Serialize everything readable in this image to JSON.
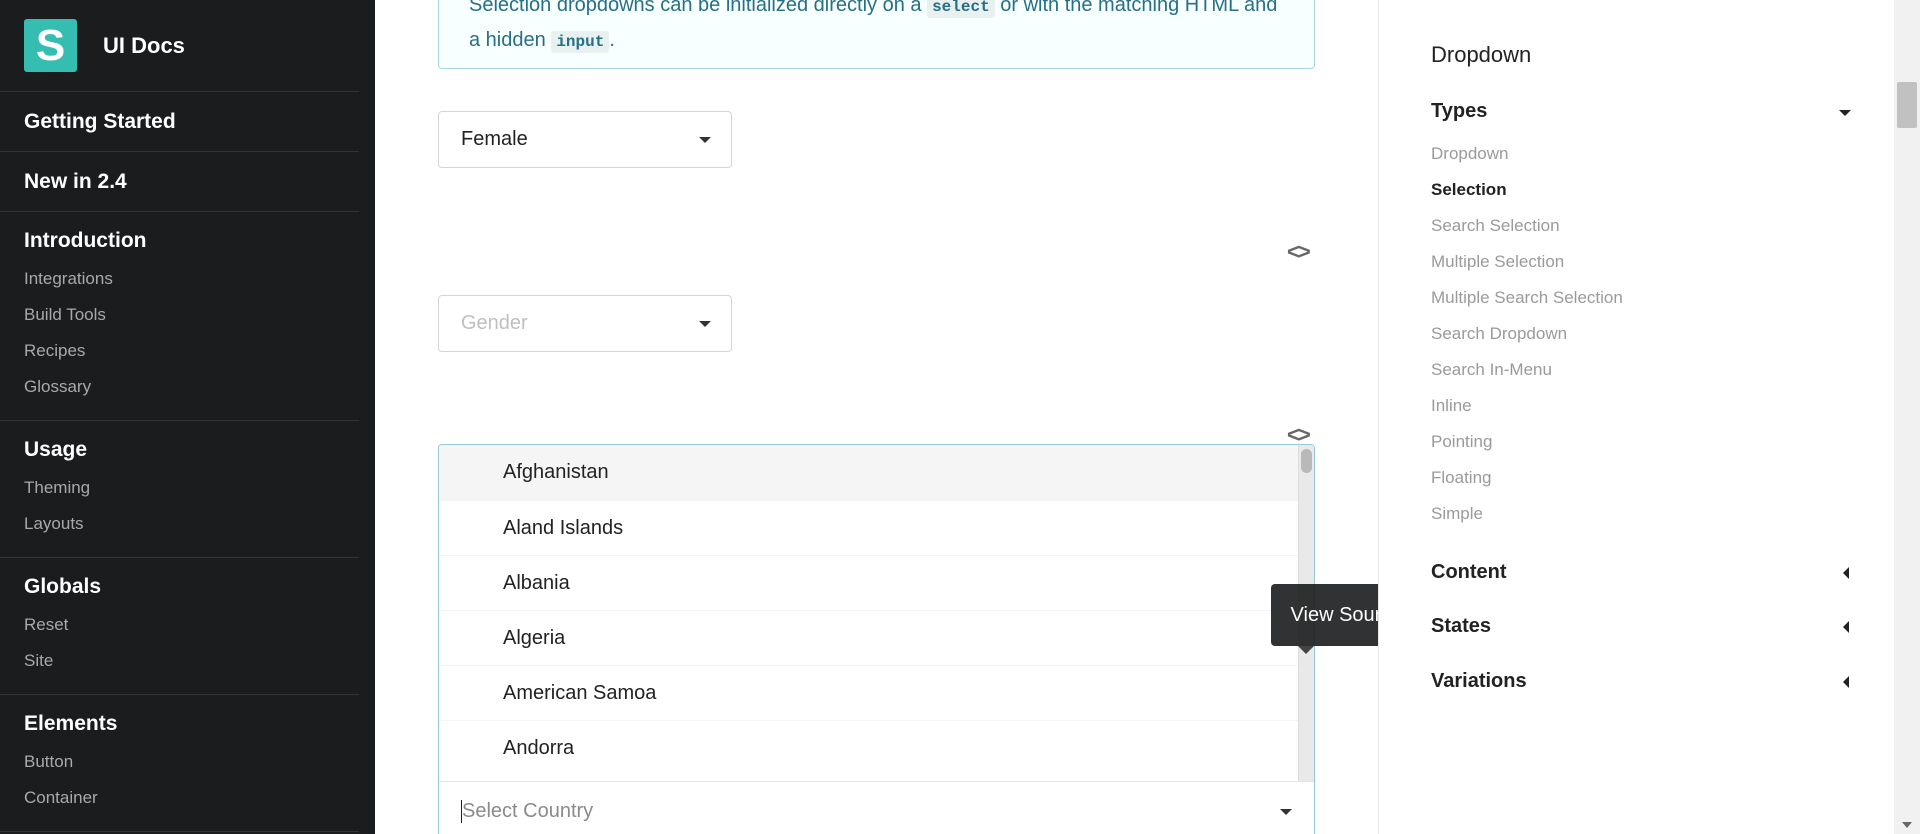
{
  "brand": {
    "logo_letter": "S",
    "title": "UI Docs",
    "accent_color": "#35bdb2"
  },
  "sidebar": {
    "singles": [
      "Getting Started",
      "New in 2.4"
    ],
    "sections": [
      {
        "header": "Introduction",
        "items": [
          "Integrations",
          "Build Tools",
          "Recipes",
          "Glossary"
        ]
      },
      {
        "header": "Usage",
        "items": [
          "Theming",
          "Layouts"
        ]
      },
      {
        "header": "Globals",
        "items": [
          "Reset",
          "Site"
        ]
      },
      {
        "header": "Elements",
        "items": [
          "Button",
          "Container"
        ]
      }
    ]
  },
  "note": {
    "text_before": "Selection dropdowns can be initialized directly on a",
    "code1": "select",
    "text_middle": "or with the matching HTML and a hidden",
    "code2": "input",
    "text_end": "."
  },
  "examples": {
    "gender_select_value": "Female",
    "gender_placeholder": "Gender",
    "code_icon": "<>"
  },
  "country_dropdown": {
    "items": [
      "Afghanistan",
      "Aland Islands",
      "Albania",
      "Algeria",
      "American Samoa",
      "Andorra"
    ],
    "placeholder": "Select Country"
  },
  "tooltip": {
    "text": "View Source"
  },
  "toc": {
    "title": "Dropdown",
    "sections": [
      "Types",
      "Content",
      "States",
      "Variations"
    ],
    "types_items": [
      "Dropdown",
      "Selection",
      "Search Selection",
      "Multiple Selection",
      "Multiple Search Selection",
      "Search Dropdown",
      "Search In-Menu",
      "Inline",
      "Pointing",
      "Floating",
      "Simple"
    ],
    "active_item": "Selection"
  }
}
